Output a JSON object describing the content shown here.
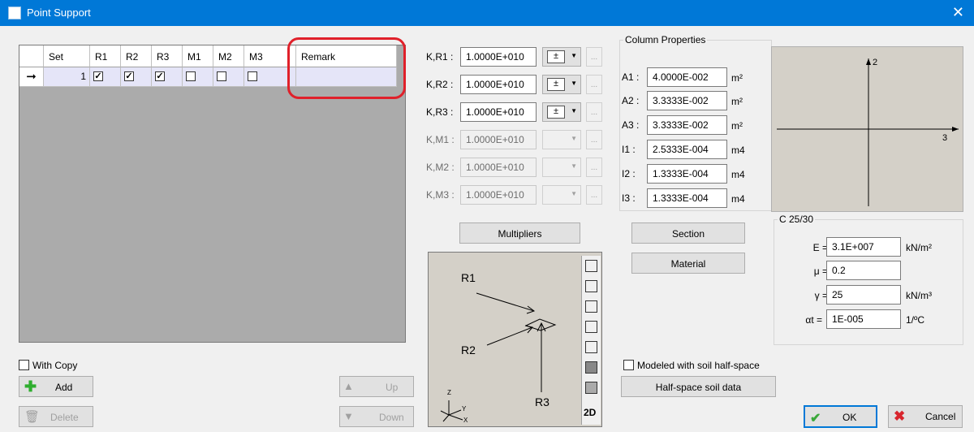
{
  "window": {
    "title": "Point Support",
    "close_glyph": "✕"
  },
  "grid": {
    "columns": [
      "Set",
      "R1",
      "R2",
      "R3",
      "M1",
      "M2",
      "M3",
      "Remark"
    ],
    "row": {
      "indicator": "➞",
      "set": "1",
      "r1": true,
      "r2": true,
      "r3": true,
      "m1": false,
      "m2": false,
      "m3": false,
      "remark": ""
    }
  },
  "left_controls": {
    "with_copy_label": "With Copy",
    "with_copy_checked": false,
    "add_label": "Add",
    "delete_label": "Delete",
    "up_label": "Up",
    "down_label": "Down"
  },
  "stiffness": {
    "rows": [
      {
        "label": "K,R1 :",
        "value": "1.0000E+010",
        "enabled": true
      },
      {
        "label": "K,R2 :",
        "value": "1.0000E+010",
        "enabled": true
      },
      {
        "label": "K,R3 :",
        "value": "1.0000E+010",
        "enabled": true
      },
      {
        "label": "K,M1 :",
        "value": "1.0000E+010",
        "enabled": false
      },
      {
        "label": "K,M2 :",
        "value": "1.0000E+010",
        "enabled": false
      },
      {
        "label": "K,M3 :",
        "value": "1.0000E+010",
        "enabled": false
      }
    ],
    "multipliers_label": "Multipliers"
  },
  "preview": {
    "labels": {
      "r1": "R1",
      "r2": "R2",
      "r3": "R3"
    },
    "mode_2d": "2D",
    "axes": {
      "z": "Z",
      "y": "Y",
      "x": "X"
    }
  },
  "column_properties": {
    "legend": "Column Properties",
    "rows": [
      {
        "label": "A1 :",
        "value": "4.0000E-002",
        "unit": "m²"
      },
      {
        "label": "A2 :",
        "value": "3.3333E-002",
        "unit": "m²"
      },
      {
        "label": "A3 :",
        "value": "3.3333E-002",
        "unit": "m²"
      },
      {
        "label": "I1 :",
        "value": "2.5333E-004",
        "unit": "m4"
      },
      {
        "label": "I2 :",
        "value": "1.3333E-004",
        "unit": "m4"
      },
      {
        "label": "I3 :",
        "value": "1.3333E-004",
        "unit": "m4"
      }
    ],
    "section_label": "Section",
    "material_label": "Material",
    "axis_labels": {
      "vertical": "2",
      "horizontal": "3"
    }
  },
  "material": {
    "legend": "C 25/30",
    "rows": [
      {
        "label": "E =",
        "value": "3.1E+007",
        "unit": "kN/m²"
      },
      {
        "label": "μ =",
        "value": "0.2",
        "unit": ""
      },
      {
        "label": "γ =",
        "value": "25",
        "unit": "kN/m³"
      },
      {
        "label": "αt =",
        "value": "1E-005",
        "unit": "1/ºC"
      }
    ]
  },
  "soil": {
    "modeled_label": "Modeled with soil half-space",
    "modeled_checked": false,
    "half_space_label": "Half-space soil data"
  },
  "footer": {
    "ok_label": "OK",
    "cancel_label": "Cancel"
  },
  "colors": {
    "title_bar": "#0078d7",
    "highlight": "#e0202a",
    "selected_row": "#e5e5f8"
  }
}
